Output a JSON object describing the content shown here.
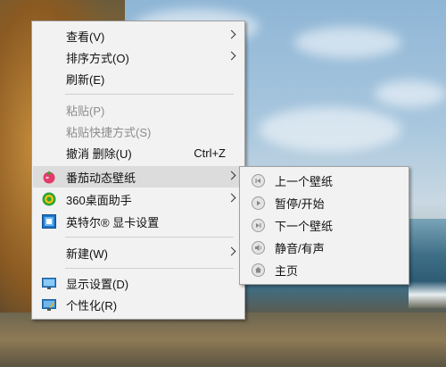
{
  "context_menu": {
    "items": [
      {
        "label": "查看(V)",
        "has_submenu": true
      },
      {
        "label": "排序方式(O)",
        "has_submenu": true
      },
      {
        "label": "刷新(E)"
      },
      {
        "label": "粘贴(P)",
        "disabled": true
      },
      {
        "label": "粘贴快捷方式(S)",
        "disabled": true
      },
      {
        "label": "撤消 删除(U)",
        "shortcut": "Ctrl+Z"
      },
      {
        "label": "番茄动态壁纸",
        "has_submenu": true,
        "highlighted": true,
        "icon": "tomato-wallpaper-icon"
      },
      {
        "label": "360桌面助手",
        "has_submenu": true,
        "icon": "360-desktop-icon"
      },
      {
        "label": "英特尔® 显卡设置",
        "icon": "intel-graphics-icon"
      },
      {
        "label": "新建(W)",
        "has_submenu": true
      },
      {
        "label": "显示设置(D)",
        "icon": "display-settings-icon"
      },
      {
        "label": "个性化(R)",
        "icon": "personalize-icon"
      }
    ]
  },
  "submenu": {
    "parent": "番茄动态壁纸",
    "items": [
      {
        "label": "上一个壁纸",
        "icon": "previous-icon"
      },
      {
        "label": "暂停/开始",
        "icon": "play-pause-icon"
      },
      {
        "label": "下一个壁纸",
        "icon": "next-icon"
      },
      {
        "label": "静音/有声",
        "icon": "volume-icon"
      },
      {
        "label": "主页",
        "icon": "home-icon"
      }
    ]
  },
  "colors": {
    "menu_bg": "#f2f2f2",
    "highlight_bg": "#dcdcdc",
    "disabled_text": "#8c8c8c",
    "border": "#a0a0a0"
  }
}
